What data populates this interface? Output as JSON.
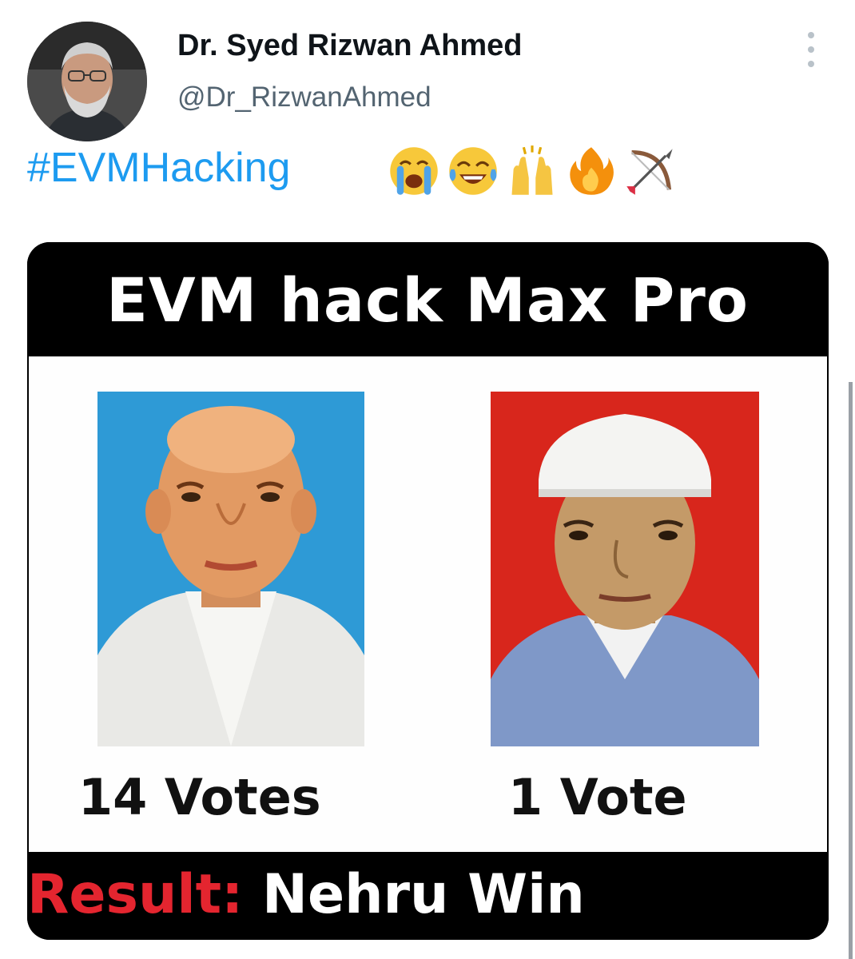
{
  "tweet": {
    "author": {
      "display_name": "Dr. Syed Rizwan Ahmed",
      "handle": "@Dr_RizwanAhmed",
      "avatar_icon": "user-avatar"
    },
    "more_icon": "more-vertical-icon",
    "text": "#EVMHacking",
    "emojis": [
      "crying-face-icon",
      "tears-of-joy-icon",
      "raising-hands-icon",
      "fire-icon",
      "bow-and-arrow-icon"
    ],
    "link_color": "#1d9bf0"
  },
  "meme": {
    "title": "EVM hack Max Pro",
    "left": {
      "votes": "14 Votes",
      "background": "#2e9ad6"
    },
    "right": {
      "votes": "1 Vote",
      "background": "#d8261c"
    },
    "result_label": "Result:",
    "result_value": " Nehru Win",
    "result_label_color": "#e4252f"
  }
}
